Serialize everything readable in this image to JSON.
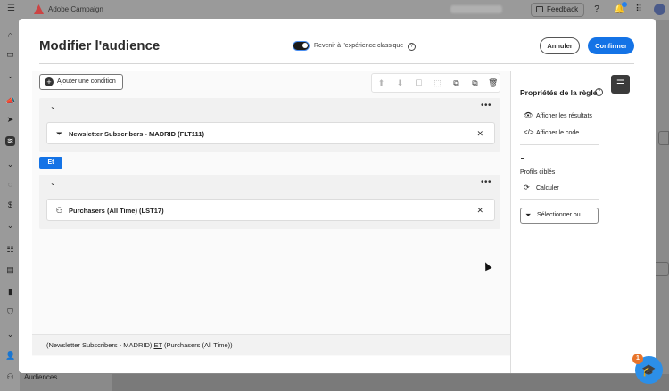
{
  "app": {
    "title": "Adobe Campaign",
    "feedback_label": "Feedback",
    "notification_count": "",
    "nav_bottom_label": "Audiences"
  },
  "modal": {
    "title": "Modifier l'audience",
    "toggle_label": "Revenir à l'expérience classique",
    "cancel_label": "Annuler",
    "confirm_label": "Confirmer"
  },
  "editor": {
    "add_condition_label": "Ajouter une condition",
    "operator_label": "Et",
    "groups": [
      {
        "condition_label": "Newsletter Subscribers - MADRID (FLT111)",
        "icon": "filter-icon"
      },
      {
        "condition_label": "Purchasers (All Time) (LST17)",
        "icon": "audience-icon"
      }
    ],
    "expression": {
      "part1": "(Newsletter Subscribers - MADRID) ",
      "operator": "ET",
      "part2": " (Purchasers (All Time))"
    }
  },
  "rule_properties": {
    "title": "Propriétés de la règle",
    "show_results_label": "Afficher les résultats",
    "show_code_label": "Afficher le code",
    "targeted_profiles_label": "Profils ciblés",
    "calculate_label": "Calculer",
    "select_label": "Sélectionner ou ..."
  },
  "learn": {
    "badge_count": "1"
  },
  "colors": {
    "accent": "#1473e6",
    "badge_orange": "#e8742a"
  }
}
